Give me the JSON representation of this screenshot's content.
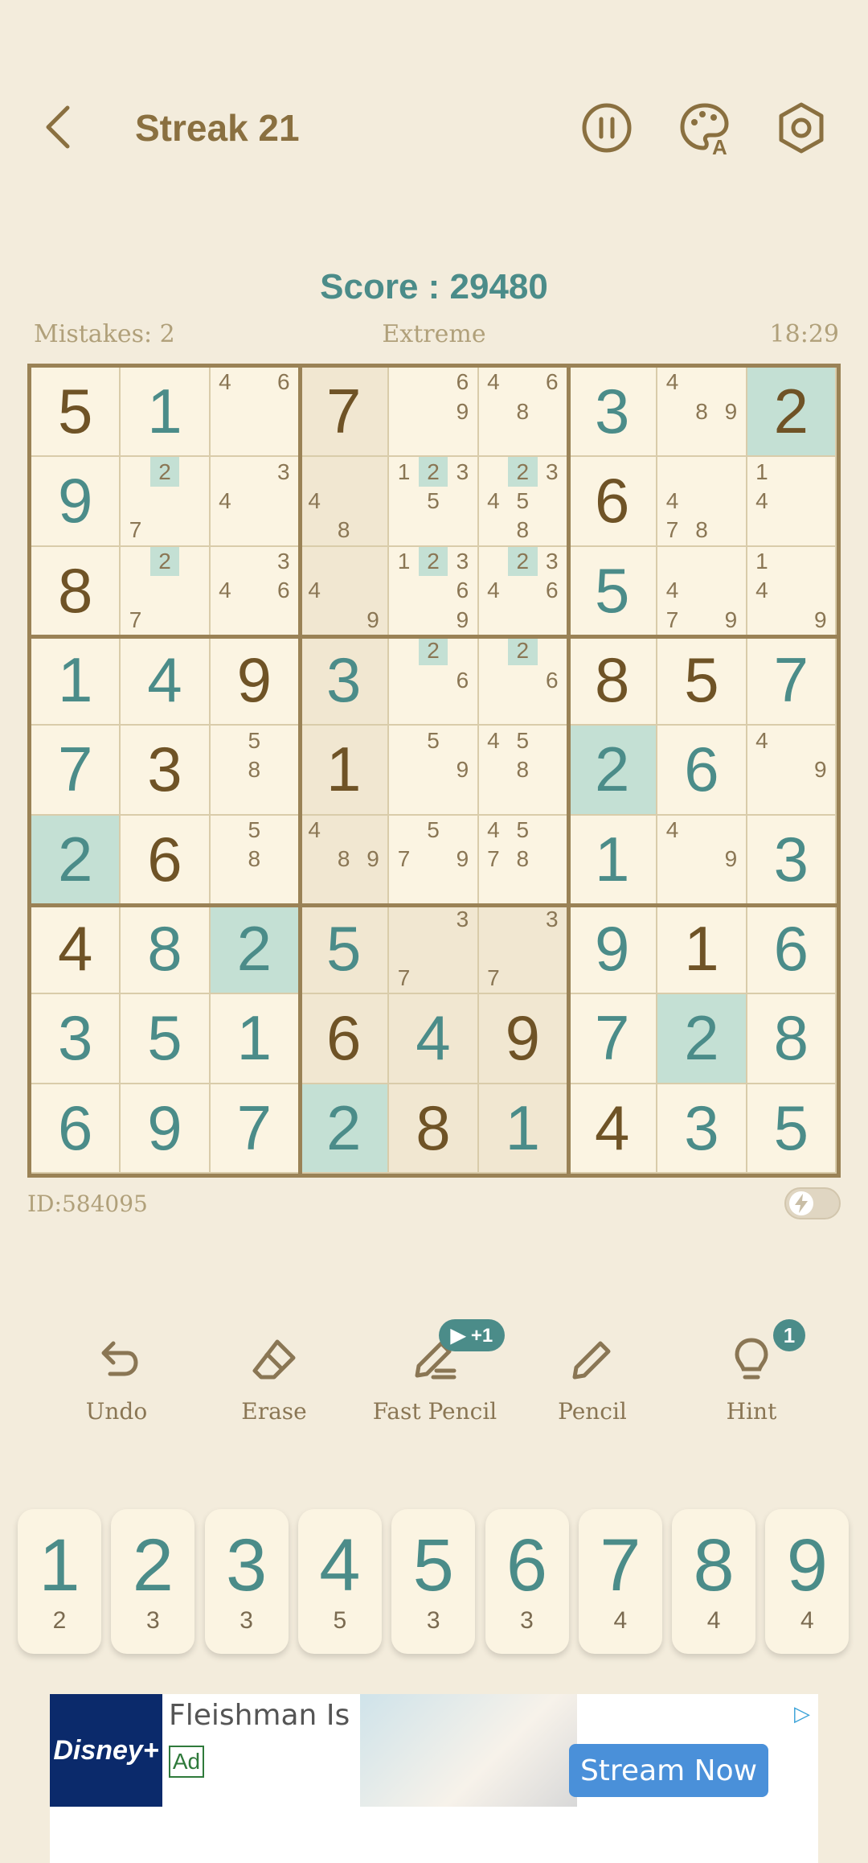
{
  "header": {
    "title": "Streak 21"
  },
  "score": "Score : 29480",
  "info": {
    "mistakes": "Mistakes: 2",
    "difficulty": "Extreme",
    "timer": "18:29"
  },
  "puzzle_id": "ID:584095",
  "board": {
    "highlight_digit": "2",
    "rows": [
      [
        {
          "v": "5",
          "t": "g"
        },
        {
          "v": "1",
          "t": "u"
        },
        {
          "n": [
            "4",
            "",
            "6",
            "",
            "",
            "",
            "",
            "",
            ""
          ]
        },
        {
          "v": "7",
          "t": "g"
        },
        {
          "n": [
            "",
            "",
            "6",
            "",
            "",
            "9",
            "",
            "",
            ""
          ]
        },
        {
          "n": [
            "4",
            "",
            "6",
            "",
            "8",
            "",
            "",
            "",
            ""
          ]
        },
        {
          "v": "3",
          "t": "u"
        },
        {
          "n": [
            "4",
            "",
            "",
            "",
            "8",
            "9",
            "",
            "",
            ""
          ]
        },
        {
          "v": "2",
          "t": "g"
        }
      ],
      [
        {
          "v": "9",
          "t": "u"
        },
        {
          "n": [
            "",
            "2",
            "",
            "",
            "",
            "",
            "7",
            "",
            ""
          ]
        },
        {
          "n": [
            "",
            "",
            "3",
            "4",
            "",
            "",
            "",
            "",
            ""
          ]
        },
        {
          "n": [
            "",
            "",
            "",
            "4",
            "",
            "",
            "",
            "8",
            ""
          ]
        },
        {
          "n": [
            "1",
            "2",
            "3",
            "",
            "5",
            "",
            "",
            "",
            ""
          ]
        },
        {
          "n": [
            "",
            "2",
            "3",
            "4",
            "5",
            "",
            "",
            "8",
            ""
          ]
        },
        {
          "v": "6",
          "t": "g"
        },
        {
          "n": [
            "",
            "",
            "",
            "4",
            "",
            "",
            "7",
            "8",
            ""
          ]
        },
        {
          "n": [
            "1",
            "",
            "",
            "4",
            "",
            "",
            "",
            "",
            ""
          ]
        }
      ],
      [
        {
          "v": "8",
          "t": "g"
        },
        {
          "n": [
            "",
            "2",
            "",
            "",
            "",
            "",
            "7",
            "",
            ""
          ]
        },
        {
          "n": [
            "",
            "",
            "3",
            "4",
            "",
            "6",
            "",
            "",
            ""
          ]
        },
        {
          "n": [
            "",
            "",
            "",
            "4",
            "",
            "",
            "",
            "",
            "9"
          ]
        },
        {
          "n": [
            "1",
            "2",
            "3",
            "",
            "",
            "6",
            "",
            "",
            "9"
          ]
        },
        {
          "n": [
            "",
            "2",
            "3",
            "4",
            "",
            "6",
            "",
            "",
            ""
          ]
        },
        {
          "v": "5",
          "t": "u"
        },
        {
          "n": [
            "",
            "",
            "",
            "4",
            "",
            "",
            "7",
            "",
            "9"
          ]
        },
        {
          "n": [
            "1",
            "",
            "",
            "4",
            "",
            "",
            "",
            "",
            "9"
          ]
        }
      ],
      [
        {
          "v": "1",
          "t": "u"
        },
        {
          "v": "4",
          "t": "u"
        },
        {
          "v": "9",
          "t": "g"
        },
        {
          "v": "3",
          "t": "u"
        },
        {
          "n": [
            "",
            "2",
            "",
            "",
            "",
            "6",
            "",
            "",
            ""
          ]
        },
        {
          "n": [
            "",
            "2",
            "",
            "",
            "",
            "6",
            "",
            "",
            ""
          ]
        },
        {
          "v": "8",
          "t": "g"
        },
        {
          "v": "5",
          "t": "g"
        },
        {
          "v": "7",
          "t": "u"
        }
      ],
      [
        {
          "v": "7",
          "t": "u"
        },
        {
          "v": "3",
          "t": "g"
        },
        {
          "n": [
            "",
            "5",
            "",
            "",
            "8",
            "",
            "",
            "",
            ""
          ]
        },
        {
          "v": "1",
          "t": "g"
        },
        {
          "n": [
            "",
            "5",
            "",
            "",
            "",
            "9",
            "",
            "",
            ""
          ]
        },
        {
          "n": [
            "4",
            "5",
            "",
            "",
            "8",
            "",
            "",
            "",
            ""
          ]
        },
        {
          "v": "2",
          "t": "u"
        },
        {
          "v": "6",
          "t": "u"
        },
        {
          "n": [
            "4",
            "",
            "",
            "",
            "",
            "9",
            "",
            "",
            ""
          ]
        }
      ],
      [
        {
          "v": "2",
          "t": "u"
        },
        {
          "v": "6",
          "t": "g"
        },
        {
          "n": [
            "",
            "5",
            "",
            "",
            "8",
            "",
            "",
            "",
            ""
          ]
        },
        {
          "n": [
            "4",
            "",
            "",
            "",
            "8",
            "9",
            "",
            "",
            ""
          ]
        },
        {
          "n": [
            "",
            "5",
            "",
            "7",
            "",
            "9",
            "",
            "",
            ""
          ]
        },
        {
          "n": [
            "4",
            "5",
            "",
            "7",
            "8",
            "",
            "",
            "",
            ""
          ]
        },
        {
          "v": "1",
          "t": "u"
        },
        {
          "n": [
            "4",
            "",
            "",
            "",
            "",
            "9",
            "",
            "",
            ""
          ]
        },
        {
          "v": "3",
          "t": "u"
        }
      ],
      [
        {
          "v": "4",
          "t": "g"
        },
        {
          "v": "8",
          "t": "u"
        },
        {
          "v": "2",
          "t": "u"
        },
        {
          "v": "5",
          "t": "u"
        },
        {
          "n": [
            "",
            "",
            "3",
            "",
            "",
            "",
            "7",
            "",
            ""
          ]
        },
        {
          "n": [
            "",
            "",
            "3",
            "",
            "",
            "",
            "7",
            "",
            ""
          ]
        },
        {
          "v": "9",
          "t": "u"
        },
        {
          "v": "1",
          "t": "g"
        },
        {
          "v": "6",
          "t": "u"
        }
      ],
      [
        {
          "v": "3",
          "t": "u"
        },
        {
          "v": "5",
          "t": "u"
        },
        {
          "v": "1",
          "t": "u"
        },
        {
          "v": "6",
          "t": "g"
        },
        {
          "v": "4",
          "t": "u"
        },
        {
          "v": "9",
          "t": "g"
        },
        {
          "v": "7",
          "t": "u"
        },
        {
          "v": "2",
          "t": "u"
        },
        {
          "v": "8",
          "t": "u"
        }
      ],
      [
        {
          "v": "6",
          "t": "u"
        },
        {
          "v": "9",
          "t": "u"
        },
        {
          "v": "7",
          "t": "u"
        },
        {
          "v": "2",
          "t": "u"
        },
        {
          "v": "8",
          "t": "g"
        },
        {
          "v": "1",
          "t": "u"
        },
        {
          "v": "4",
          "t": "g"
        },
        {
          "v": "3",
          "t": "u"
        },
        {
          "v": "5",
          "t": "u"
        }
      ]
    ],
    "highlight_region": "column 4 and 3x3 box containing row 7 column 5-6"
  },
  "tools": {
    "undo": "Undo",
    "erase": "Erase",
    "fast_pencil": "Fast Pencil",
    "fast_pencil_badge": "▶ +1",
    "pencil": "Pencil",
    "hint": "Hint",
    "hint_badge": "1"
  },
  "numpad": [
    {
      "digit": "1",
      "count": "2"
    },
    {
      "digit": "2",
      "count": "3"
    },
    {
      "digit": "3",
      "count": "3"
    },
    {
      "digit": "4",
      "count": "5"
    },
    {
      "digit": "5",
      "count": "3"
    },
    {
      "digit": "6",
      "count": "3"
    },
    {
      "digit": "7",
      "count": "4"
    },
    {
      "digit": "8",
      "count": "4"
    },
    {
      "digit": "9",
      "count": "4"
    }
  ],
  "ad": {
    "logo": "Disney+",
    "title": "Fleishman Is In Trouble",
    "tag": "Ad",
    "cta": "Stream Now"
  },
  "colors": {
    "background": "#f3ecdc",
    "accent": "#4b8c89",
    "given": "#6f5326",
    "highlight": "#c4e0d4"
  }
}
